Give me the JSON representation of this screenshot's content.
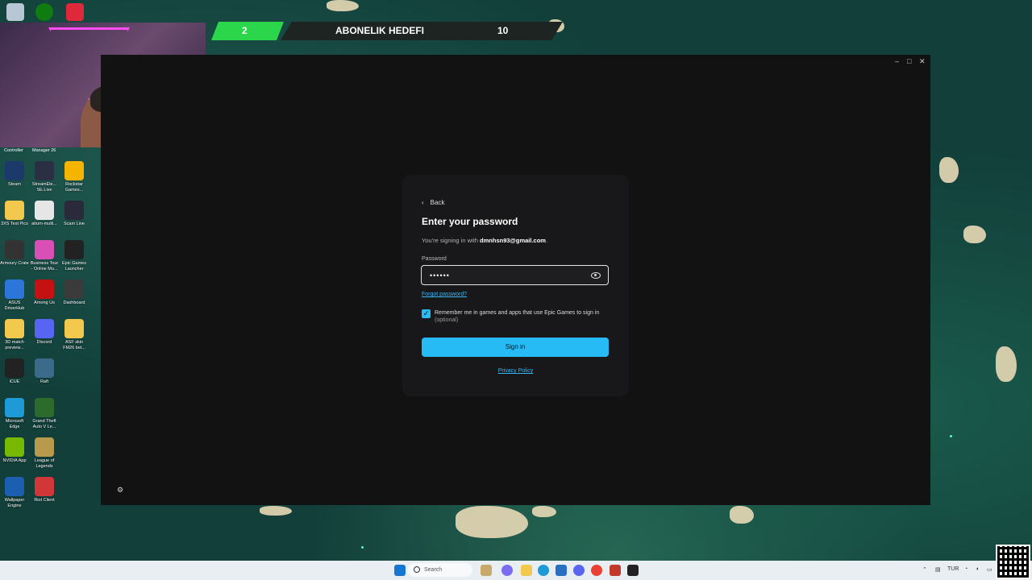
{
  "overlay": {
    "goal_current": "2",
    "goal_title": "ABONELIK HEDEFI",
    "goal_target": "10"
  },
  "desktop": {
    "top_labels": [
      "Controller",
      "Manager 26"
    ],
    "icons": [
      {
        "label": "Steam",
        "icon": "steam-icon",
        "color": "#1b3a6b"
      },
      {
        "label": "StreamEle... SE.Live",
        "icon": "streamelements-icon",
        "color": "#2b2f44"
      },
      {
        "label": "Rockstar Games...",
        "icon": "rockstar-icon",
        "color": "#f5b400"
      },
      {
        "label": "3XS Test Pics",
        "icon": "folder-icon",
        "color": "#f2c94c"
      },
      {
        "label": "aiturn-multi...",
        "icon": "settings-file-icon",
        "color": "#e6e6e6"
      },
      {
        "label": "Scam Line",
        "icon": "scam-line-icon",
        "color": "#2a2a3a"
      },
      {
        "label": "Armoury Crate",
        "icon": "armoury-crate-icon",
        "color": "#333"
      },
      {
        "label": "Business Tour - Online Mu...",
        "icon": "business-tour-icon",
        "color": "#d94fb5"
      },
      {
        "label": "Epic Games Launcher",
        "icon": "epic-games-icon",
        "color": "#222"
      },
      {
        "label": "ASUS DriverHub",
        "icon": "asus-driverhub-icon",
        "color": "#2b76d8"
      },
      {
        "label": "Among Us",
        "icon": "among-us-icon",
        "color": "#c51111"
      },
      {
        "label": "Dashboard",
        "icon": "dashboard-icon",
        "color": "#3b3b3b"
      },
      {
        "label": "3D match preview...",
        "icon": "folder-icon",
        "color": "#f2c94c"
      },
      {
        "label": "Discord",
        "icon": "discord-icon",
        "color": "#5865f2"
      },
      {
        "label": "ASF skin FM26 bet...",
        "icon": "folder-icon",
        "color": "#f2c94c"
      },
      {
        "label": "iCUE",
        "icon": "icue-icon",
        "color": "#222"
      },
      {
        "label": "Raft",
        "icon": "raft-icon",
        "color": "#3b6a8a"
      },
      {
        "label": "Microsoft Edge",
        "icon": "edge-icon",
        "color": "#1e9bd7"
      },
      {
        "label": "Grand Theft Auto V Le...",
        "icon": "gta-icon",
        "color": "#2d6b2d"
      },
      {
        "label": "NVIDIA App",
        "icon": "nvidia-icon",
        "color": "#76b900"
      },
      {
        "label": "League of Legends",
        "icon": "league-icon",
        "color": "#b89a4c"
      },
      {
        "label": "Wallpaper Engine",
        "icon": "wallpaper-engine-icon",
        "color": "#1c5fb0"
      },
      {
        "label": "Riot Client",
        "icon": "riot-client-icon",
        "color": "#d13639"
      }
    ]
  },
  "window_controls": {
    "minimize": "–",
    "maximize": "□",
    "close": "✕"
  },
  "login": {
    "back_label": "Back",
    "title": "Enter your password",
    "signing_in_prefix": "You're signing in with ",
    "email": "dmnhsn93@gmail.com",
    "signing_in_suffix": ".",
    "password_label": "Password",
    "password_value": "••••••",
    "forgot_label": "Forgot password?",
    "remember_label": "Remember me in games and apps that use Epic Games to sign in",
    "remember_optional": "(optional)",
    "remember_checked": true,
    "signin_label": "Sign in",
    "privacy_label": "Privacy Policy",
    "accent_color": "#26bbf5"
  },
  "taskbar": {
    "search_placeholder": "Search",
    "language": "TUR"
  }
}
